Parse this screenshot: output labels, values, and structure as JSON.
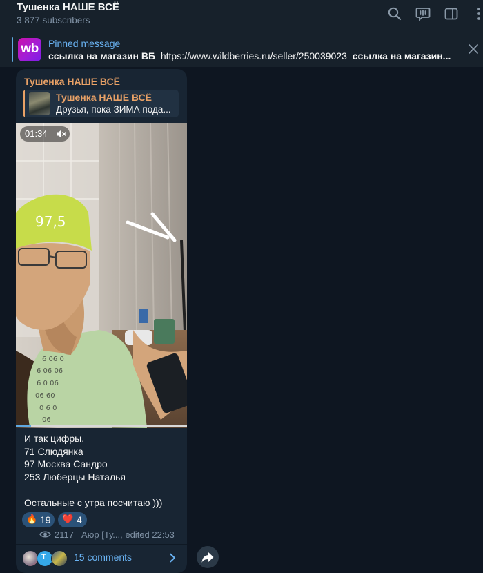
{
  "channel": {
    "title": "Тушенка НАШЕ ВСЁ",
    "subscribers": "3 877 subscribers"
  },
  "header_icons": [
    "search-icon",
    "live-chat-icon",
    "sidebar-toggle-icon",
    "more-vertical-icon"
  ],
  "pinned": {
    "label": "Pinned message",
    "logo_text": "wb",
    "text_lead": "ссылка на магазин ВБ",
    "url": "https://www.wildberries.ru/seller/250039023",
    "text_tail": "ссылка на магазин...",
    "close_icon": "close-icon"
  },
  "post": {
    "author": "Тушенка НАШЕ ВСЁ",
    "reply": {
      "name": "Тушенка НАШЕ ВСЁ",
      "text": "Друзья, пока ЗИМА пода..."
    },
    "video": {
      "duration": "01:34",
      "muted": true,
      "progress": 0.09,
      "cap_text": "97,5"
    },
    "lines": [
      "И так цифры.",
      "71 Слюдянка",
      "97 Москва Сандро",
      "253 Люберцы Наталья",
      "",
      "Остальные с утра посчитаю )))"
    ],
    "reactions": [
      {
        "emoji": "🔥",
        "count": "19"
      },
      {
        "emoji": "❤️",
        "count": "4"
      }
    ],
    "views": "2117",
    "signature": "Аюр [Ту..., edited 22:53",
    "comments_label": "15 comments"
  },
  "colors": {
    "accent": "#6ab3f3",
    "author": "#e9a166",
    "bubble": "#182533",
    "background": "#0e1621"
  }
}
